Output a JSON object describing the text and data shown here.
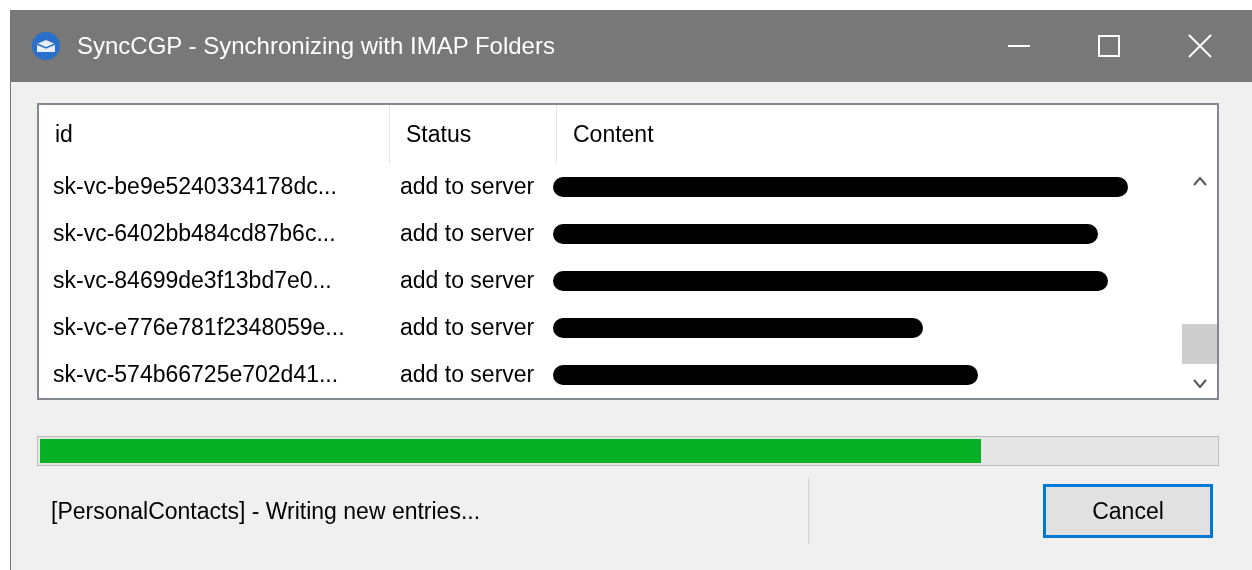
{
  "window": {
    "title": "SyncCGP - Synchronizing with IMAP Folders"
  },
  "table": {
    "columns": [
      "id",
      "Status",
      "Content"
    ],
    "rows": [
      {
        "id": "sk-vc-be9e5240334178dc...",
        "status": "add to server",
        "content": {
          "kind": "redacted"
        }
      },
      {
        "id": "sk-vc-6402bb484cd87b6c...",
        "status": "add to server",
        "content": {
          "kind": "redacted"
        }
      },
      {
        "id": "sk-vc-84699de3f13bd7e0...",
        "status": "add to server",
        "content": {
          "kind": "redacted"
        }
      },
      {
        "id": "sk-vc-e776e781f2348059e...",
        "status": "add to server",
        "content": {
          "kind": "redacted"
        }
      },
      {
        "id": "sk-vc-574b66725e702d41...",
        "status": "add to server",
        "content": {
          "kind": "redacted"
        }
      }
    ]
  },
  "progress": {
    "level": 0.8
  },
  "status_text": "[PersonalContacts] - Writing new entries...",
  "buttons": [
    {
      "label": "Cancel",
      "kind": "default"
    }
  ]
}
